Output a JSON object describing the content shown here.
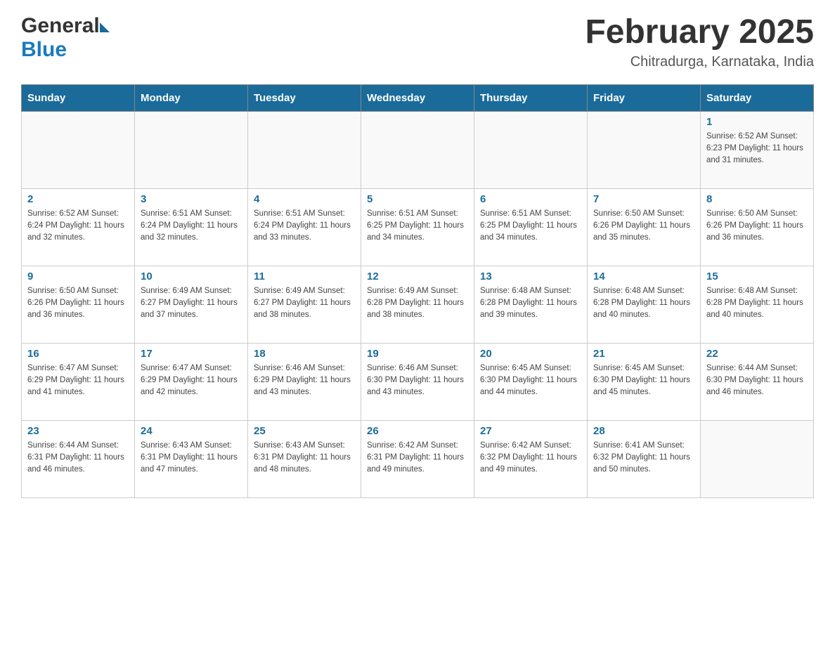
{
  "header": {
    "logo_general": "General",
    "logo_blue": "Blue",
    "month_title": "February 2025",
    "location": "Chitradurga, Karnataka, India"
  },
  "days_of_week": [
    "Sunday",
    "Monday",
    "Tuesday",
    "Wednesday",
    "Thursday",
    "Friday",
    "Saturday"
  ],
  "weeks": [
    [
      {
        "day": "",
        "info": ""
      },
      {
        "day": "",
        "info": ""
      },
      {
        "day": "",
        "info": ""
      },
      {
        "day": "",
        "info": ""
      },
      {
        "day": "",
        "info": ""
      },
      {
        "day": "",
        "info": ""
      },
      {
        "day": "1",
        "info": "Sunrise: 6:52 AM\nSunset: 6:23 PM\nDaylight: 11 hours and 31 minutes."
      }
    ],
    [
      {
        "day": "2",
        "info": "Sunrise: 6:52 AM\nSunset: 6:24 PM\nDaylight: 11 hours and 32 minutes."
      },
      {
        "day": "3",
        "info": "Sunrise: 6:51 AM\nSunset: 6:24 PM\nDaylight: 11 hours and 32 minutes."
      },
      {
        "day": "4",
        "info": "Sunrise: 6:51 AM\nSunset: 6:24 PM\nDaylight: 11 hours and 33 minutes."
      },
      {
        "day": "5",
        "info": "Sunrise: 6:51 AM\nSunset: 6:25 PM\nDaylight: 11 hours and 34 minutes."
      },
      {
        "day": "6",
        "info": "Sunrise: 6:51 AM\nSunset: 6:25 PM\nDaylight: 11 hours and 34 minutes."
      },
      {
        "day": "7",
        "info": "Sunrise: 6:50 AM\nSunset: 6:26 PM\nDaylight: 11 hours and 35 minutes."
      },
      {
        "day": "8",
        "info": "Sunrise: 6:50 AM\nSunset: 6:26 PM\nDaylight: 11 hours and 36 minutes."
      }
    ],
    [
      {
        "day": "9",
        "info": "Sunrise: 6:50 AM\nSunset: 6:26 PM\nDaylight: 11 hours and 36 minutes."
      },
      {
        "day": "10",
        "info": "Sunrise: 6:49 AM\nSunset: 6:27 PM\nDaylight: 11 hours and 37 minutes."
      },
      {
        "day": "11",
        "info": "Sunrise: 6:49 AM\nSunset: 6:27 PM\nDaylight: 11 hours and 38 minutes."
      },
      {
        "day": "12",
        "info": "Sunrise: 6:49 AM\nSunset: 6:28 PM\nDaylight: 11 hours and 38 minutes."
      },
      {
        "day": "13",
        "info": "Sunrise: 6:48 AM\nSunset: 6:28 PM\nDaylight: 11 hours and 39 minutes."
      },
      {
        "day": "14",
        "info": "Sunrise: 6:48 AM\nSunset: 6:28 PM\nDaylight: 11 hours and 40 minutes."
      },
      {
        "day": "15",
        "info": "Sunrise: 6:48 AM\nSunset: 6:28 PM\nDaylight: 11 hours and 40 minutes."
      }
    ],
    [
      {
        "day": "16",
        "info": "Sunrise: 6:47 AM\nSunset: 6:29 PM\nDaylight: 11 hours and 41 minutes."
      },
      {
        "day": "17",
        "info": "Sunrise: 6:47 AM\nSunset: 6:29 PM\nDaylight: 11 hours and 42 minutes."
      },
      {
        "day": "18",
        "info": "Sunrise: 6:46 AM\nSunset: 6:29 PM\nDaylight: 11 hours and 43 minutes."
      },
      {
        "day": "19",
        "info": "Sunrise: 6:46 AM\nSunset: 6:30 PM\nDaylight: 11 hours and 43 minutes."
      },
      {
        "day": "20",
        "info": "Sunrise: 6:45 AM\nSunset: 6:30 PM\nDaylight: 11 hours and 44 minutes."
      },
      {
        "day": "21",
        "info": "Sunrise: 6:45 AM\nSunset: 6:30 PM\nDaylight: 11 hours and 45 minutes."
      },
      {
        "day": "22",
        "info": "Sunrise: 6:44 AM\nSunset: 6:30 PM\nDaylight: 11 hours and 46 minutes."
      }
    ],
    [
      {
        "day": "23",
        "info": "Sunrise: 6:44 AM\nSunset: 6:31 PM\nDaylight: 11 hours and 46 minutes."
      },
      {
        "day": "24",
        "info": "Sunrise: 6:43 AM\nSunset: 6:31 PM\nDaylight: 11 hours and 47 minutes."
      },
      {
        "day": "25",
        "info": "Sunrise: 6:43 AM\nSunset: 6:31 PM\nDaylight: 11 hours and 48 minutes."
      },
      {
        "day": "26",
        "info": "Sunrise: 6:42 AM\nSunset: 6:31 PM\nDaylight: 11 hours and 49 minutes."
      },
      {
        "day": "27",
        "info": "Sunrise: 6:42 AM\nSunset: 6:32 PM\nDaylight: 11 hours and 49 minutes."
      },
      {
        "day": "28",
        "info": "Sunrise: 6:41 AM\nSunset: 6:32 PM\nDaylight: 11 hours and 50 minutes."
      },
      {
        "day": "",
        "info": ""
      }
    ]
  ]
}
